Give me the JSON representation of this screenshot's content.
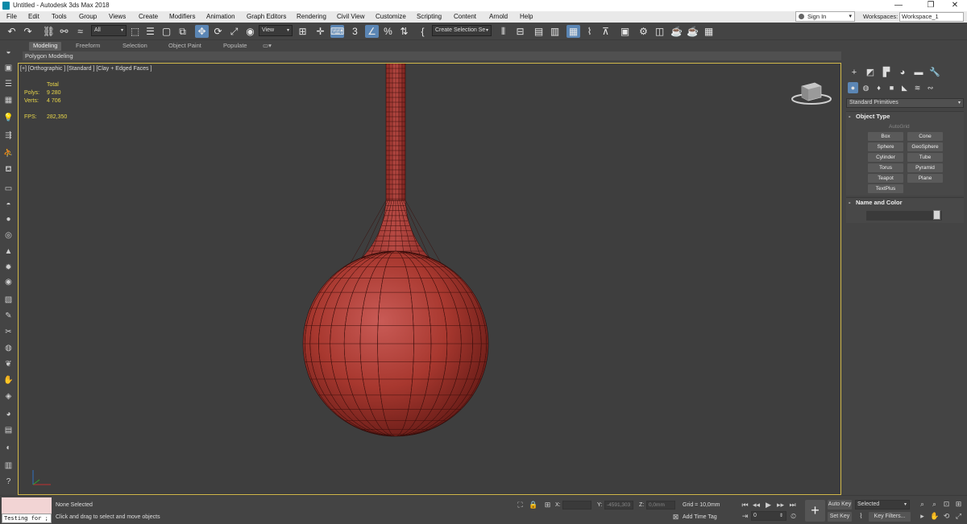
{
  "window": {
    "title": "Untitled - Autodesk 3ds Max 2018",
    "minimize": "—",
    "maximize": "❐",
    "close": "✕"
  },
  "menu": [
    "File",
    "Edit",
    "Tools",
    "Group",
    "Views",
    "Create",
    "Modifiers",
    "Animation",
    "Graph Editors",
    "Rendering",
    "Civil View",
    "Customize",
    "Scripting",
    "Content",
    "Arnold",
    "Help"
  ],
  "account": {
    "sign_in": "Sign In",
    "workspaces_label": "Workspaces:",
    "workspace": "Workspace_1"
  },
  "toolbar": {
    "selection_filter": "All",
    "ref_coord": "View",
    "named_selection": "Create Selection Se"
  },
  "ribbon": {
    "tabs": [
      "Modeling",
      "Freeform",
      "Selection",
      "Object Paint",
      "Populate"
    ],
    "active_tab": "Modeling",
    "panel": "Polygon Modeling"
  },
  "viewport": {
    "label": "[+] [Orthographic ] [Standard ] [Clay + Edged Faces ]",
    "stats_header": "Total",
    "polys_label": "Polys:",
    "polys": "9 280",
    "verts_label": "Verts:",
    "verts": "4 706",
    "fps_label": "FPS:",
    "fps": "282,350",
    "object_color": "#b3403c"
  },
  "command_panel": {
    "category": "Standard Primitives",
    "object_type_title": "Object Type",
    "autogrid": "AutoGrid",
    "primitives": [
      "Box",
      "Cone",
      "Sphere",
      "GeoSphere",
      "Cylinder",
      "Tube",
      "Torus",
      "Pyramid",
      "Teapot",
      "Plane",
      "TextPlus"
    ],
    "name_color_title": "Name and Color",
    "collapse_sign": "-"
  },
  "status": {
    "maxscript_text": "Testing for ;",
    "selection": "None Selected",
    "prompt": "Click and drag to select and move objects",
    "x_label": "X:",
    "y_label": "Y:",
    "y_value": "-4591,303",
    "z_label": "Z:",
    "z_value": "0,0mm",
    "grid": "Grid = 10,0mm",
    "add_time_tag": "Add Time Tag",
    "frame": "0",
    "auto_key": "Auto Key",
    "set_key": "Set Key",
    "key_selection": "Selected",
    "key_filters": "Key Filters..."
  },
  "colors": {
    "accent": "#5b86b5",
    "viewport_border": "#d2b94a",
    "stats_text": "#e8d64a"
  }
}
